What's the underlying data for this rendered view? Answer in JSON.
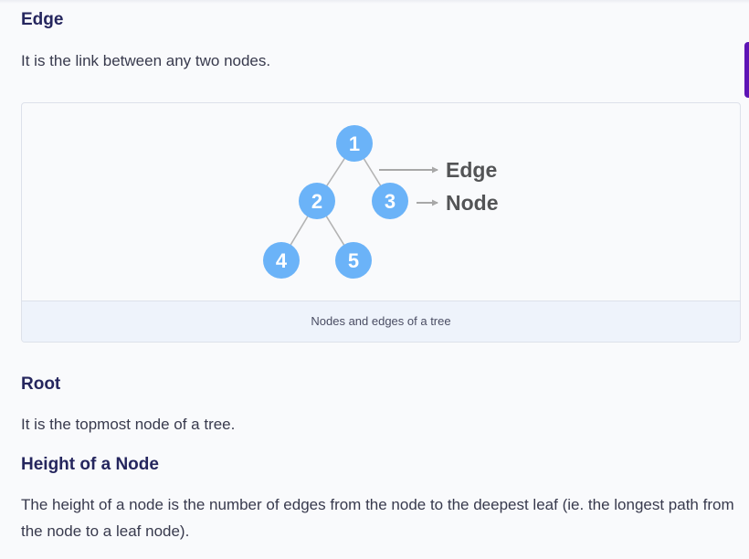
{
  "sections": {
    "edge": {
      "heading": "Edge",
      "description": "It is the link between any two nodes."
    },
    "root": {
      "heading": "Root",
      "description": "It is the topmost node of a tree."
    },
    "height": {
      "heading": "Height of a Node",
      "description": "The height of a node is the number of edges from the node to the deepest leaf (ie. the longest path from the node to a leaf node)."
    }
  },
  "figure": {
    "caption": "Nodes and edges of a tree",
    "nodes": [
      "1",
      "2",
      "3",
      "4",
      "5"
    ],
    "edges": [
      [
        "1",
        "2"
      ],
      [
        "1",
        "3"
      ],
      [
        "2",
        "4"
      ],
      [
        "2",
        "5"
      ]
    ],
    "labels": {
      "edge": "Edge",
      "node": "Node"
    },
    "colors": {
      "node_fill": "#6bb3f8",
      "node_text": "#ffffff",
      "edge_line": "#b3b3b3",
      "label_text": "#535456",
      "arrow": "#a8a8a8"
    }
  },
  "colors": {
    "heading": "#25265e",
    "body_text": "#383a4d",
    "accent_tab": "#5d14b5"
  }
}
